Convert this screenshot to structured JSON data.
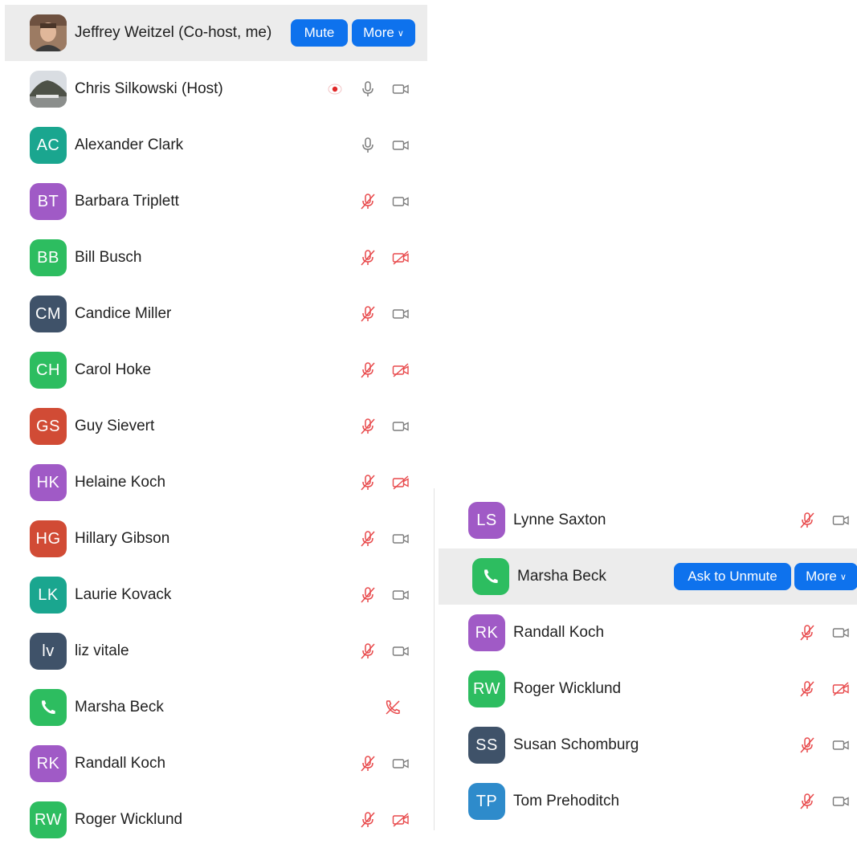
{
  "colors": {
    "accent_button": "#0e72ed",
    "muted_red": "#e8494b",
    "icon_gray": "#7b7b7b",
    "highlight_row": "#ececec",
    "avatar_teal": "#1aa68f",
    "avatar_purple": "#a05ac6",
    "avatar_green": "#2dbd60",
    "avatar_slate": "#3f5269",
    "avatar_red": "#d14b35",
    "avatar_blue": "#2e8bcb"
  },
  "left_panel": {
    "self": {
      "name": "Jeffrey Weitzel (Co-host, me)",
      "avatar": "photo",
      "mute_label": "Mute",
      "more_label": "More"
    },
    "participants": [
      {
        "initials": "",
        "avatar": "photo-landscape",
        "name": "Chris Silkowski (Host)",
        "recording": true,
        "mic": "on",
        "video": "off"
      },
      {
        "initials": "AC",
        "color": "teal",
        "name": "Alexander Clark",
        "mic": "on",
        "video": "off"
      },
      {
        "initials": "BT",
        "color": "purple",
        "name": "Barbara Triplett",
        "mic": "muted",
        "video": "off"
      },
      {
        "initials": "BB",
        "color": "green",
        "name": "Bill Busch",
        "mic": "muted",
        "video": "stopped"
      },
      {
        "initials": "CM",
        "color": "slate",
        "name": "Candice Miller",
        "mic": "muted",
        "video": "off"
      },
      {
        "initials": "CH",
        "color": "green",
        "name": "Carol Hoke",
        "mic": "muted",
        "video": "stopped"
      },
      {
        "initials": "GS",
        "color": "red",
        "name": "Guy Sievert",
        "mic": "muted",
        "video": "off"
      },
      {
        "initials": "HK",
        "color": "purple",
        "name": "Helaine Koch",
        "mic": "muted",
        "video": "stopped"
      },
      {
        "initials": "HG",
        "color": "red",
        "name": "Hillary Gibson",
        "mic": "muted",
        "video": "off"
      },
      {
        "initials": "LK",
        "color": "teal",
        "name": "Laurie Kovack",
        "mic": "muted",
        "video": "off"
      },
      {
        "initials": "lv",
        "color": "slate",
        "name": "liz vitale",
        "mic": "muted",
        "video": "off"
      },
      {
        "initials": "",
        "avatar": "phone",
        "color": "green",
        "name": "Marsha Beck",
        "mic": "phone-muted",
        "video": "none"
      },
      {
        "initials": "RK",
        "color": "purple",
        "name": "Randall Koch",
        "mic": "muted",
        "video": "off"
      },
      {
        "initials": "RW",
        "color": "green",
        "name": "Roger Wicklund",
        "mic": "muted",
        "video": "stopped"
      }
    ]
  },
  "right_panel": {
    "participants": [
      {
        "initials": "LS",
        "color": "purple",
        "name": "Lynne Saxton",
        "mic": "muted",
        "video": "off"
      },
      {
        "initials": "",
        "avatar": "phone",
        "color": "green",
        "name": "Marsha Beck",
        "highlight": true,
        "ask_label": "Ask to Unmute",
        "more_label": "More"
      },
      {
        "initials": "RK",
        "color": "purple",
        "name": "Randall Koch",
        "mic": "muted",
        "video": "off"
      },
      {
        "initials": "RW",
        "color": "green",
        "name": "Roger Wicklund",
        "mic": "muted",
        "video": "stopped"
      },
      {
        "initials": "SS",
        "color": "slate",
        "name": "Susan Schomburg",
        "mic": "muted",
        "video": "off"
      },
      {
        "initials": "TP",
        "color": "blue",
        "name": "Tom Prehoditch",
        "mic": "muted",
        "video": "off"
      }
    ]
  }
}
